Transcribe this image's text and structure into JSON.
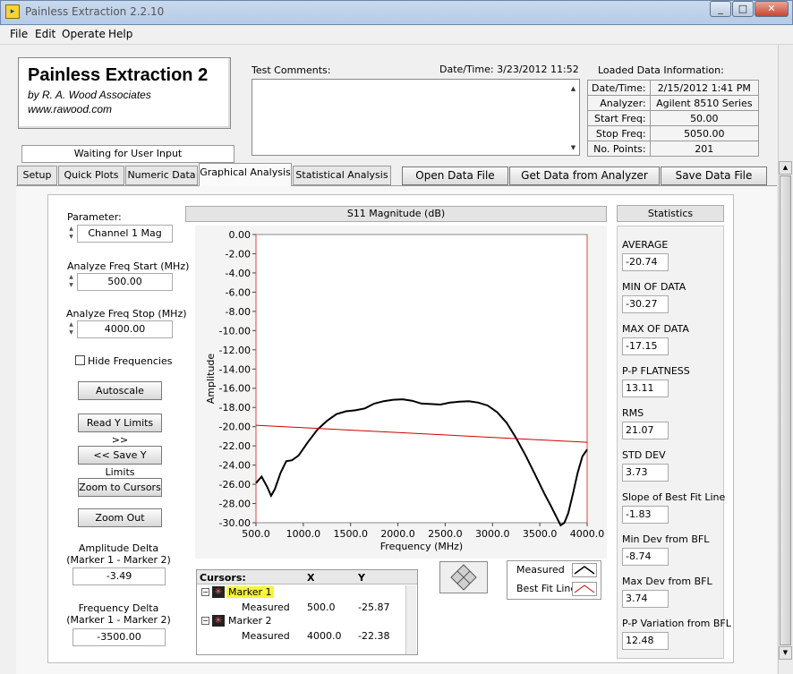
{
  "window": {
    "title": "Painless Extraction 2.2.10",
    "controls": [
      "_",
      "□",
      "✕"
    ]
  },
  "menu": [
    "File",
    "Edit",
    "Operate",
    "Help"
  ],
  "header": {
    "app_name": "Painless Extraction 2",
    "author": "by R. A. Wood Associates",
    "website": "www.rawood.com",
    "status": "Waiting for User Input"
  },
  "comments": {
    "label": "Test Comments:",
    "datetime_label": "Date/Time:  3/23/2012  11:52",
    "value": ""
  },
  "loaded": {
    "label": "Loaded Data Information:",
    "rows": [
      {
        "key": "Date/Time:",
        "value": "2/15/2012 1:41 PM"
      },
      {
        "key": "Analyzer:",
        "value": "Agilent 8510 Series"
      },
      {
        "key": "Start Freq:",
        "value": "50.00"
      },
      {
        "key": "Stop Freq:",
        "value": "5050.00"
      },
      {
        "key": "No. Points:",
        "value": "201"
      }
    ]
  },
  "tabs": [
    "Setup",
    "Quick Plots",
    "Numeric Data",
    "Graphical Analysis",
    "Statistical Analysis"
  ],
  "active_tab": "Graphical Analysis",
  "actions": {
    "open": "Open Data File",
    "get": "Get Data from Analyzer",
    "save": "Save Data File"
  },
  "controls": {
    "parameter_label": "Parameter:",
    "parameter_value": "Channel 1 Mag",
    "start_label": "Analyze Freq Start (MHz)",
    "start_value": "500.00",
    "stop_label": "Analyze Freq Stop (MHz)",
    "stop_value": "4000.00",
    "hide_freq_label": "Hide Frequencies",
    "hide_freq_checked": false,
    "autoscale": "Autoscale",
    "read_y": "Read Y Limits >>",
    "save_y": "<< Save Y Limits",
    "zoom_cursors": "Zoom to Cursors",
    "zoom_out": "Zoom Out",
    "amp_delta_label1": "Amplitude Delta",
    "amp_delta_label2": "(Marker 1 - Marker 2)",
    "amp_delta_value": "-3.49",
    "freq_delta_label1": "Frequency Delta",
    "freq_delta_label2": "(Marker 1 - Marker 2)",
    "freq_delta_value": "-3500.00"
  },
  "cursors": {
    "headers": [
      "Cursors:",
      "X",
      "Y"
    ],
    "markers": [
      {
        "name": "Marker 1",
        "sub": "Measured",
        "x": "500.0",
        "y": "-25.87",
        "highlight": true
      },
      {
        "name": "Marker 2",
        "sub": "Measured",
        "x": "4000.0",
        "y": "-22.38",
        "highlight": false
      }
    ]
  },
  "legend": [
    {
      "name": "Measured",
      "color": "#000000"
    },
    {
      "name": "Best Fit Line",
      "color": "#cc0000"
    }
  ],
  "stats": {
    "header": "Statistics",
    "items": [
      {
        "label": "AVERAGE",
        "value": "-20.74"
      },
      {
        "label": "MIN OF DATA",
        "value": "-30.27"
      },
      {
        "label": "MAX OF DATA",
        "value": "-17.15"
      },
      {
        "label": "P-P FLATNESS",
        "value": "13.11"
      },
      {
        "label": "RMS",
        "value": "21.07"
      },
      {
        "label": "STD DEV",
        "value": "3.73"
      },
      {
        "label": "Slope of Best Fit Line",
        "value": "-1.83"
      },
      {
        "label": "Min Dev from BFL",
        "value": "-8.74"
      },
      {
        "label": "Max Dev from BFL",
        "value": "3.74"
      },
      {
        "label": "P-P Variation from BFL",
        "value": "12.48"
      }
    ]
  },
  "chart_data": {
    "type": "line",
    "title": "S11 Magnitude (dB)",
    "xlabel": "Frequency (MHz)",
    "ylabel": "Amplitude",
    "xlim": [
      500,
      4000
    ],
    "ylim": [
      -30,
      0
    ],
    "x_ticks": [
      "500.0",
      "1000.0",
      "1500.0",
      "2000.0",
      "2500.0",
      "3000.0",
      "3500.0",
      "4000.0"
    ],
    "y_ticks": [
      "0.00",
      "-2.00",
      "-4.00",
      "-6.00",
      "-8.00",
      "-10.00",
      "-12.00",
      "-14.00",
      "-16.00",
      "-18.00",
      "-20.00",
      "-22.00",
      "-24.00",
      "-26.00",
      "-28.00",
      "-30.00"
    ],
    "series": [
      {
        "name": "Measured",
        "color": "#000000",
        "x": [
          500,
          560,
          620,
          660,
          700,
          760,
          820,
          880,
          950,
          1050,
          1150,
          1250,
          1350,
          1450,
          1550,
          1650,
          1750,
          1850,
          1950,
          2050,
          2150,
          2250,
          2350,
          2450,
          2550,
          2650,
          2750,
          2850,
          2950,
          3050,
          3150,
          3250,
          3350,
          3450,
          3550,
          3620,
          3680,
          3720,
          3760,
          3800,
          3850,
          3900,
          3950,
          4000
        ],
        "y": [
          -25.87,
          -25.2,
          -26.3,
          -27.2,
          -26.5,
          -24.8,
          -23.6,
          -23.5,
          -23.0,
          -21.6,
          -20.3,
          -19.4,
          -18.7,
          -18.4,
          -18.3,
          -18.1,
          -17.6,
          -17.35,
          -17.2,
          -17.15,
          -17.3,
          -17.6,
          -17.65,
          -17.7,
          -17.5,
          -17.4,
          -17.35,
          -17.5,
          -17.8,
          -18.5,
          -19.6,
          -21.2,
          -23.0,
          -25.0,
          -27.0,
          -28.3,
          -29.5,
          -30.27,
          -30.0,
          -29.0,
          -27.0,
          -24.8,
          -23.1,
          -22.38
        ]
      },
      {
        "name": "Best Fit Line",
        "color": "#cc0000",
        "x": [
          500,
          4000
        ],
        "y": [
          -19.85,
          -21.62
        ]
      }
    ],
    "cursor_lines": [
      500,
      4000
    ]
  }
}
